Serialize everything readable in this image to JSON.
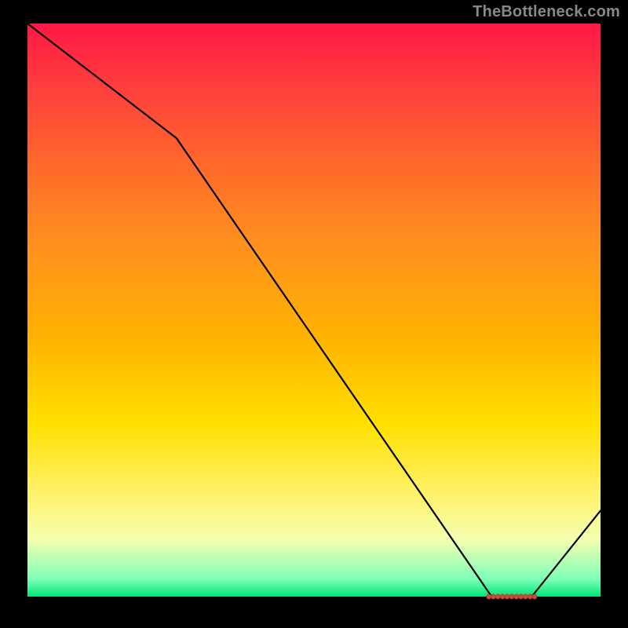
{
  "attribution": "TheBottleneck.com",
  "chart_data": {
    "type": "line",
    "title": "",
    "xlabel": "",
    "ylabel": "",
    "xlim": [
      0,
      100
    ],
    "ylim": [
      0,
      100
    ],
    "series": [
      {
        "name": "curve",
        "x": [
          0,
          26,
          81,
          88,
          100
        ],
        "values": [
          100,
          80,
          0,
          0,
          15
        ]
      }
    ],
    "markers": {
      "name": "optimal-range",
      "points": [
        {
          "x": 80.5,
          "y": 0
        },
        {
          "x": 81.3,
          "y": 0
        },
        {
          "x": 82.1,
          "y": 0
        },
        {
          "x": 82.9,
          "y": 0
        },
        {
          "x": 83.7,
          "y": 0
        },
        {
          "x": 84.5,
          "y": 0
        },
        {
          "x": 85.3,
          "y": 0
        },
        {
          "x": 86.1,
          "y": 0
        },
        {
          "x": 86.9,
          "y": 0
        },
        {
          "x": 87.7,
          "y": 0
        },
        {
          "x": 88.5,
          "y": 0
        }
      ]
    },
    "gradient_stops": [
      {
        "pos": 0,
        "color": "#ff1744"
      },
      {
        "pos": 10,
        "color": "#ff3b3f"
      },
      {
        "pos": 25,
        "color": "#ff6a2a"
      },
      {
        "pos": 38,
        "color": "#ff8f1f"
      },
      {
        "pos": 55,
        "color": "#ffb300"
      },
      {
        "pos": 70,
        "color": "#ffe000"
      },
      {
        "pos": 82,
        "color": "#fff26a"
      },
      {
        "pos": 90,
        "color": "#f5ffb0"
      },
      {
        "pos": 97,
        "color": "#7cffb8"
      },
      {
        "pos": 100,
        "color": "#00e676"
      }
    ]
  }
}
